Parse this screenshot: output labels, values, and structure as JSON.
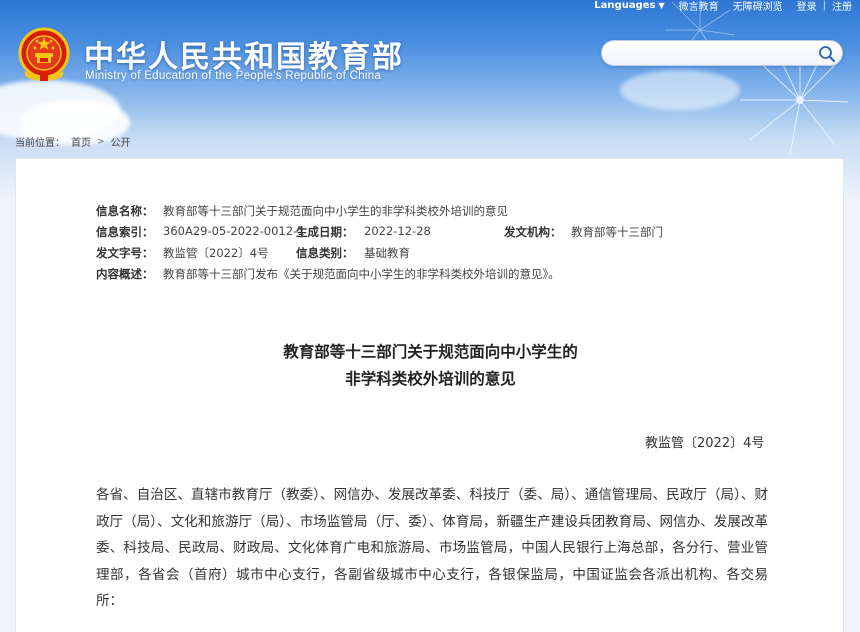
{
  "header": {
    "links": {
      "languages": "Languages",
      "weibo": "微言教育",
      "accessibility": "无障碍浏览",
      "login": "登录",
      "separator": "|",
      "register": "注册"
    },
    "title_cn": "中华人民共和国教育部",
    "title_en": "Ministry of Education of the People's Republic of China",
    "search": {
      "value": "",
      "placeholder": ""
    }
  },
  "breadcrumb": {
    "prefix": "当前位置：",
    "home": "首页",
    "current": "公开"
  },
  "meta": {
    "name_label": "信息名称：",
    "name_value": "教育部等十三部门关于规范面向中小学生的非学科类校外培训的意见",
    "index_label": "信息索引：",
    "index_value": "360A29-05-2022-0012-1",
    "date_label": "生成日期：",
    "date_value": "2022-12-28",
    "org_label": "发文机构：",
    "org_value": "教育部等十三部门",
    "docno_label": "发文字号：",
    "docno_value": "教监管〔2022〕4号",
    "category_label": "信息类别：",
    "category_value": "基础教育",
    "summary_label": "内容概述：",
    "summary_value": "教育部等十三部门发布《关于规范面向中小学生的非学科类校外培训的意见》。"
  },
  "article": {
    "title_line1": "教育部等十三部门关于规范面向中小学生的",
    "title_line2": "非学科类校外培训的意见",
    "doc_number": "教监管〔2022〕4号",
    "paragraph1": "各省、自治区、直辖市教育厅（教委）、网信办、发展改革委、科技厅（委、局）、通信管理局、民政厅（局）、财政厅（局）、文化和旅游厅（局）、市场监管局（厅、委）、体育局，新疆生产建设兵团教育局、网信办、发展改革委、科技局、民政局、财政局、文化体育广电和旅游局、市场监管局，中国人民银行上海总部，各分行、营业管理部，各省会（首府）城市中心支行，各副省级城市中心支行，各银保监局，中国证监会各派出机构、各交易所："
  },
  "colors": {
    "sky_top": "#2d76d3",
    "sky_bottom": "#eef3fa",
    "panel_bg": "#ffffff",
    "page_bg": "#f0f4f9"
  },
  "icons": [
    "national-emblem-icon",
    "search-icon",
    "chevron-right-icon",
    "caret-down-icon"
  ]
}
